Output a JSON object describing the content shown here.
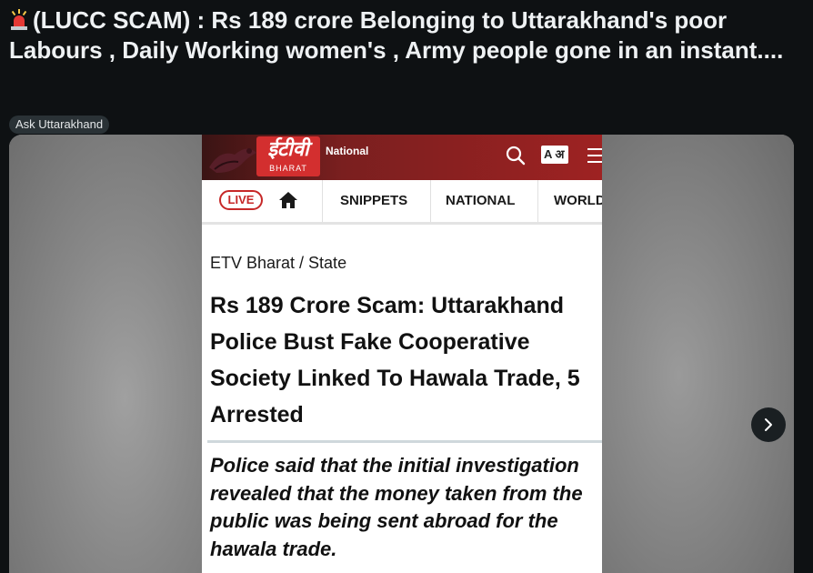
{
  "post": {
    "title": "(LUCC SCAM) : Rs 189 crore Belonging to Uttarakhand's poor Labours , Daily Working women's , Army people gone in an instant....",
    "title_icon": "police-siren-icon",
    "flair": "Ask Uttarakhand"
  },
  "screenshot": {
    "brand": {
      "logo_text": "ईटीवी",
      "logo_sub": "BHARAT",
      "section": "National"
    },
    "language_button": "A अ",
    "nav": {
      "live": "LIVE",
      "items": [
        "SNIPPETS",
        "NATIONAL",
        "WORLD"
      ]
    },
    "breadcrumb": "ETV Bharat / State",
    "headline": "Rs 189 Crore Scam: Uttarakhand Police Bust Fake Cooperative Society Linked To Hawala Trade, 5 Arrested",
    "summary": "Police said that the initial investigation revealed that the money taken from the public was being sent abroad for the hawala trade."
  },
  "gallery": {
    "next_icon": "chevron-right-icon"
  },
  "colors": {
    "background": "#0e1113",
    "flair_bg": "#2a3236",
    "etv_red": "#c62828",
    "header_dark": "#7a1f1f"
  }
}
